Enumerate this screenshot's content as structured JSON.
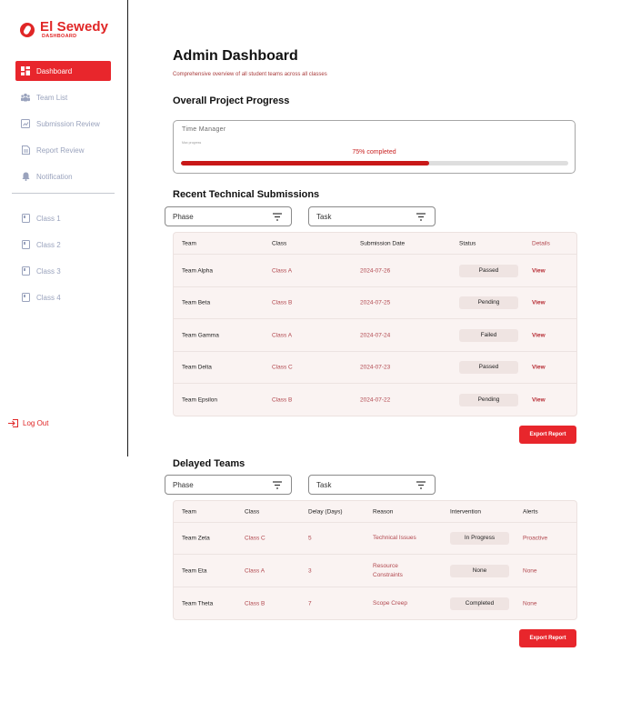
{
  "brand": {
    "name": "El Sewedy",
    "sub": "DASHBOARD",
    "color": "#e02626"
  },
  "sidebar": {
    "items": [
      {
        "label": "Dashboard",
        "icon": "dashboard-icon",
        "active": true
      },
      {
        "label": "Team List",
        "icon": "team-icon"
      },
      {
        "label": "Submission Review",
        "icon": "submission-icon"
      },
      {
        "label": "Report Review",
        "icon": "report-icon"
      },
      {
        "label": "Notification",
        "icon": "bell-icon"
      }
    ],
    "classes": [
      {
        "label": "Class 1",
        "icon": "class-icon"
      },
      {
        "label": "Class 2",
        "icon": "class-icon"
      },
      {
        "label": "Class 3",
        "icon": "class-icon"
      },
      {
        "label": "Class 4",
        "icon": "class-icon"
      }
    ],
    "logout": "Log Out"
  },
  "page": {
    "title": "Admin Dashboard",
    "subtitle": "Comprehensive overview of all student teams across all classes"
  },
  "progress": {
    "section_title": "Overall Project Progress",
    "card_title": "Time Manager",
    "card_sub": "Max progress",
    "label": "75% completed",
    "value": 0.64
  },
  "submissions": {
    "section_title": "Recent Technical Submissions",
    "filters": {
      "phase": "Phase",
      "task": "Task"
    },
    "headers": [
      "Team",
      "Class",
      "Submission Date",
      "Status",
      "Details"
    ],
    "rows": [
      {
        "team": "Team Alpha",
        "class": "Class A",
        "date": "2024-07-26",
        "status": "Passed",
        "details": "View"
      },
      {
        "team": "Team Beta",
        "class": "Class B",
        "date": "2024-07-25",
        "status": "Pending",
        "details": "View"
      },
      {
        "team": "Team Gamma",
        "class": "Class A",
        "date": "2024-07-24",
        "status": "Failed",
        "details": "View"
      },
      {
        "team": "Team Delta",
        "class": "Class C",
        "date": "2024-07-23",
        "status": "Passed",
        "details": "View"
      },
      {
        "team": "Team Epsilon",
        "class": "Class B",
        "date": "2024-07-22",
        "status": "Pending",
        "details": "View"
      }
    ],
    "export_label": "Export Report"
  },
  "delayed": {
    "section_title": "Delayed Teams",
    "filters": {
      "phase": "Phase",
      "task": "Task"
    },
    "headers": [
      "Team",
      "Class",
      "Delay (Days)",
      "Reason",
      "Intervention",
      "Alerts"
    ],
    "rows": [
      {
        "team": "Team Zeta",
        "class": "Class C",
        "delay": "5",
        "reason": [
          "Technical Issues"
        ],
        "intervention": "In Progress",
        "alert": "Proactive"
      },
      {
        "team": "Team Eta",
        "class": "Class A",
        "delay": "3",
        "reason": [
          "Resource",
          "Constraints"
        ],
        "intervention": "None",
        "alert": "None"
      },
      {
        "team": "Team Theta",
        "class": "Class B",
        "delay": "7",
        "reason": [
          "Scope Creep"
        ],
        "intervention": "Completed",
        "alert": "None"
      }
    ],
    "export_label": "Export Report"
  }
}
